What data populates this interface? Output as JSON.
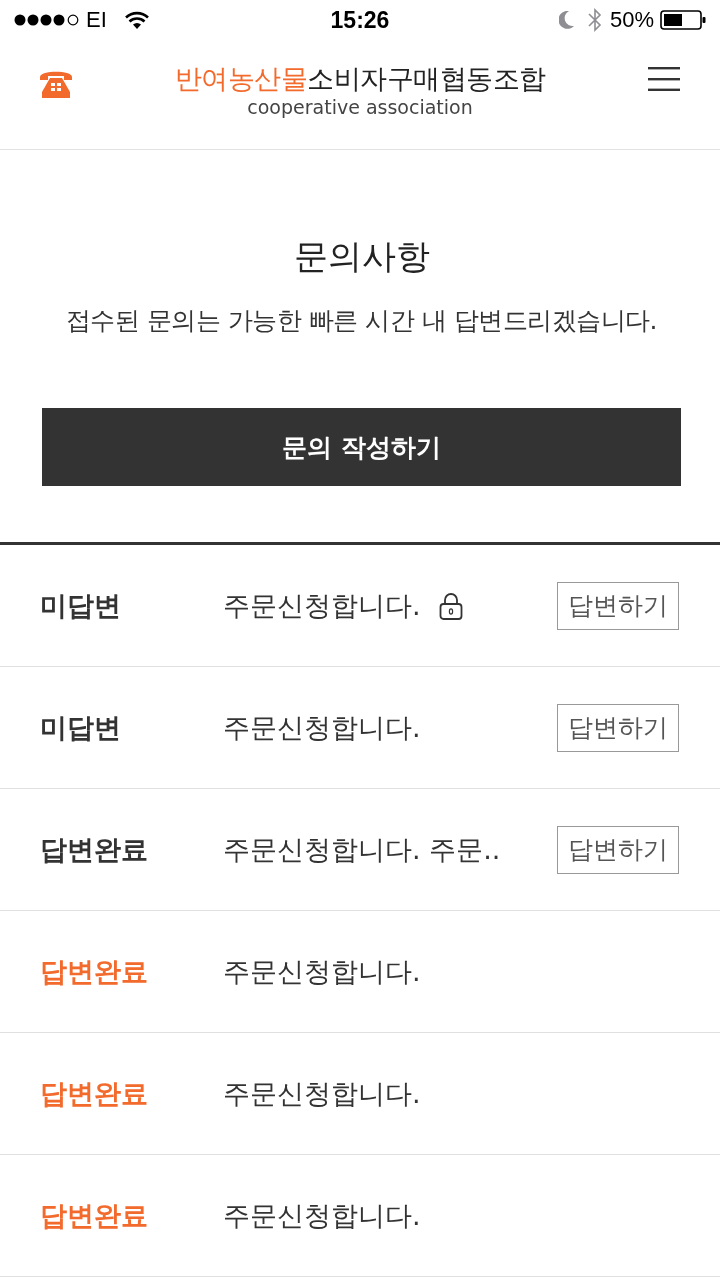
{
  "status_bar": {
    "carrier": "EI",
    "time": "15:26",
    "battery": "50%"
  },
  "header": {
    "logo_highlight": "반여농산물",
    "logo_name": "소비자구매협동조합",
    "logo_subtitle": "cooperative association"
  },
  "intro": {
    "title": "문의사항",
    "description": "접수된 문의는 가능한 빠른 시간 내 답변드리겠습니다.",
    "write_button": "문의 작성하기"
  },
  "inquiries": [
    {
      "status": "미답변",
      "color": "#333333",
      "title": "주문신청합니다.",
      "locked": true,
      "reply_button": "답변하기"
    },
    {
      "status": "미답변",
      "color": "#333333",
      "title": "주문신청합니다.",
      "locked": false,
      "reply_button": "답변하기"
    },
    {
      "status": "답변완료",
      "color": "#333333",
      "title": "주문신청합니다. 주문..",
      "locked": false,
      "reply_button": "답변하기"
    },
    {
      "status": "답변완료",
      "color": "#f26a2c",
      "title": "주문신청합니다.",
      "locked": false
    },
    {
      "status": "답변완료",
      "color": "#f26a2c",
      "title": "주문신청합니다.",
      "locked": false
    },
    {
      "status": "답변완료",
      "color": "#f26a2c",
      "title": "주문신청합니다.",
      "locked": false
    }
  ]
}
